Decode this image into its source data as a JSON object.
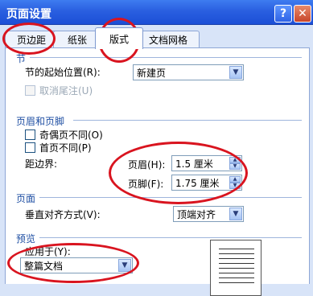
{
  "window": {
    "title": "页面设置"
  },
  "title_buttons": {
    "help": "?",
    "close": "✕"
  },
  "tabs": [
    {
      "label": "页边距"
    },
    {
      "label": "纸张"
    },
    {
      "label": "版式"
    },
    {
      "label": "文档网格"
    }
  ],
  "section_sec": {
    "title": "节",
    "start_label": "节的起始位置(R):",
    "start_value": "新建页",
    "suppress_endnotes": "取消尾注(U)"
  },
  "headers": {
    "title": "页眉和页脚",
    "odd_even": "奇偶页不同(O)",
    "first_page": "首页不同(P)",
    "from_edge": "距边界:",
    "header_label": "页眉(H):",
    "header_value": "1.5 厘米",
    "footer_label": "页脚(F):",
    "footer_value": "1.75 厘米"
  },
  "page": {
    "title": "页面",
    "valign_label": "垂直对齐方式(V):",
    "valign_value": "顶端对齐"
  },
  "preview": {
    "title": "预览",
    "apply_label": "应用于(Y):",
    "apply_value": "整篇文档"
  },
  "icons": {
    "dropdown": "chevron-down-icon",
    "spin_up": "spin-up-icon",
    "spin_down": "spin-down-icon"
  },
  "colors": {
    "title_bar": "#2a5fe0",
    "section_title": "#1f4fa3",
    "annotation": "#d9141f"
  }
}
